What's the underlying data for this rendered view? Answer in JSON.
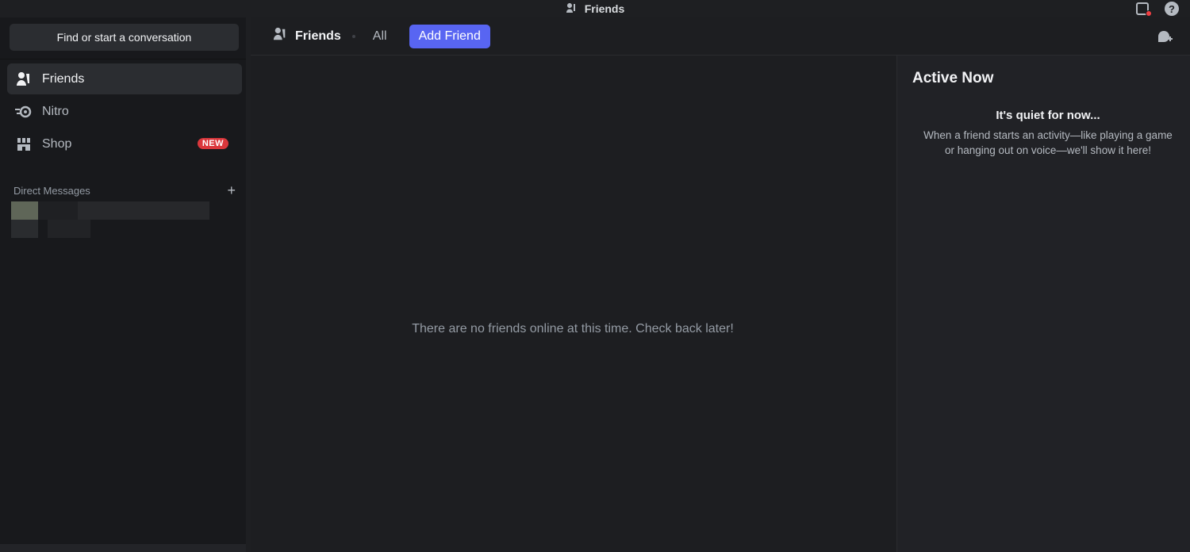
{
  "window": {
    "title": "Friends"
  },
  "sidebar": {
    "search_label": "Find or start a conversation",
    "items": [
      {
        "label": "Friends",
        "icon": "friends-icon",
        "active": true
      },
      {
        "label": "Nitro",
        "icon": "nitro-icon",
        "active": false
      },
      {
        "label": "Shop",
        "icon": "shop-icon",
        "active": false,
        "badge": "NEW"
      }
    ],
    "dm_header": "Direct Messages",
    "dm_add": "+"
  },
  "topbar": {
    "friends_label": "Friends",
    "tab_all": "All",
    "add_friend": "Add Friend"
  },
  "main": {
    "empty_message": "There are no friends online at this time. Check back later!"
  },
  "active_now": {
    "heading": "Active Now",
    "quiet_title": "It's quiet for now...",
    "quiet_body": "When a friend starts an activity—like playing a game or hanging out on voice—we'll show it here!"
  },
  "colors": {
    "accent": "#5865f2",
    "badge": "#da373c",
    "background": "#1e1f22",
    "sidebar": "#18191c"
  }
}
